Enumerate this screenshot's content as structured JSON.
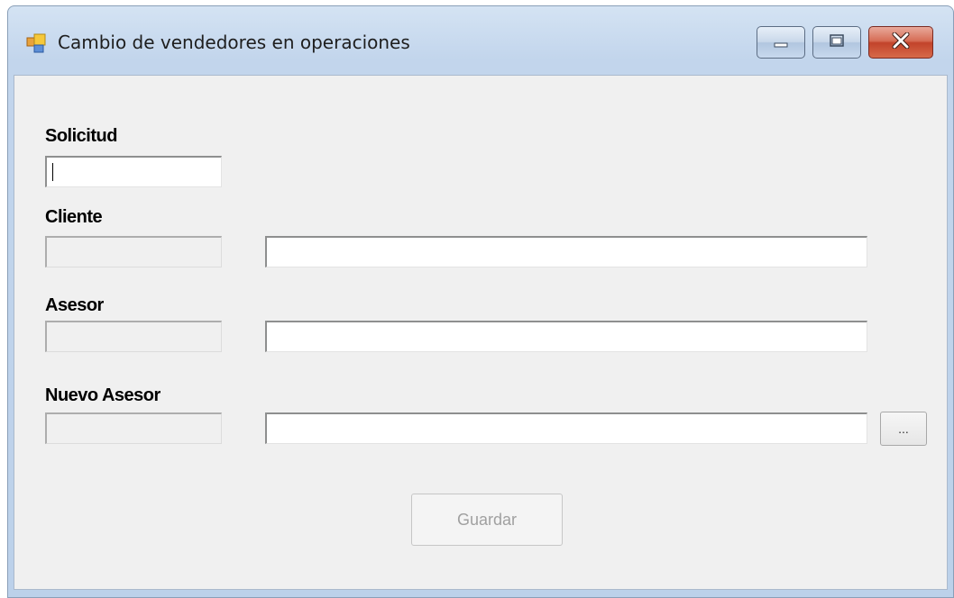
{
  "window": {
    "title": "Cambio de vendedores en operaciones",
    "controls": [
      "minimize",
      "maximize",
      "close"
    ]
  },
  "form": {
    "solicitud": {
      "label": "Solicitud",
      "value": ""
    },
    "cliente": {
      "label": "Cliente",
      "code": "",
      "name": ""
    },
    "asesor": {
      "label": "Asesor",
      "code": "",
      "name": ""
    },
    "nuevo_asesor": {
      "label": "Nuevo Asesor",
      "code": "",
      "name": "",
      "browse_label": "..."
    },
    "save_label": "Guardar",
    "save_enabled": false
  },
  "colors": {
    "client_bg": "#f0f0f0",
    "frame": "#bcd1ea",
    "close_button": "#c2432a"
  }
}
